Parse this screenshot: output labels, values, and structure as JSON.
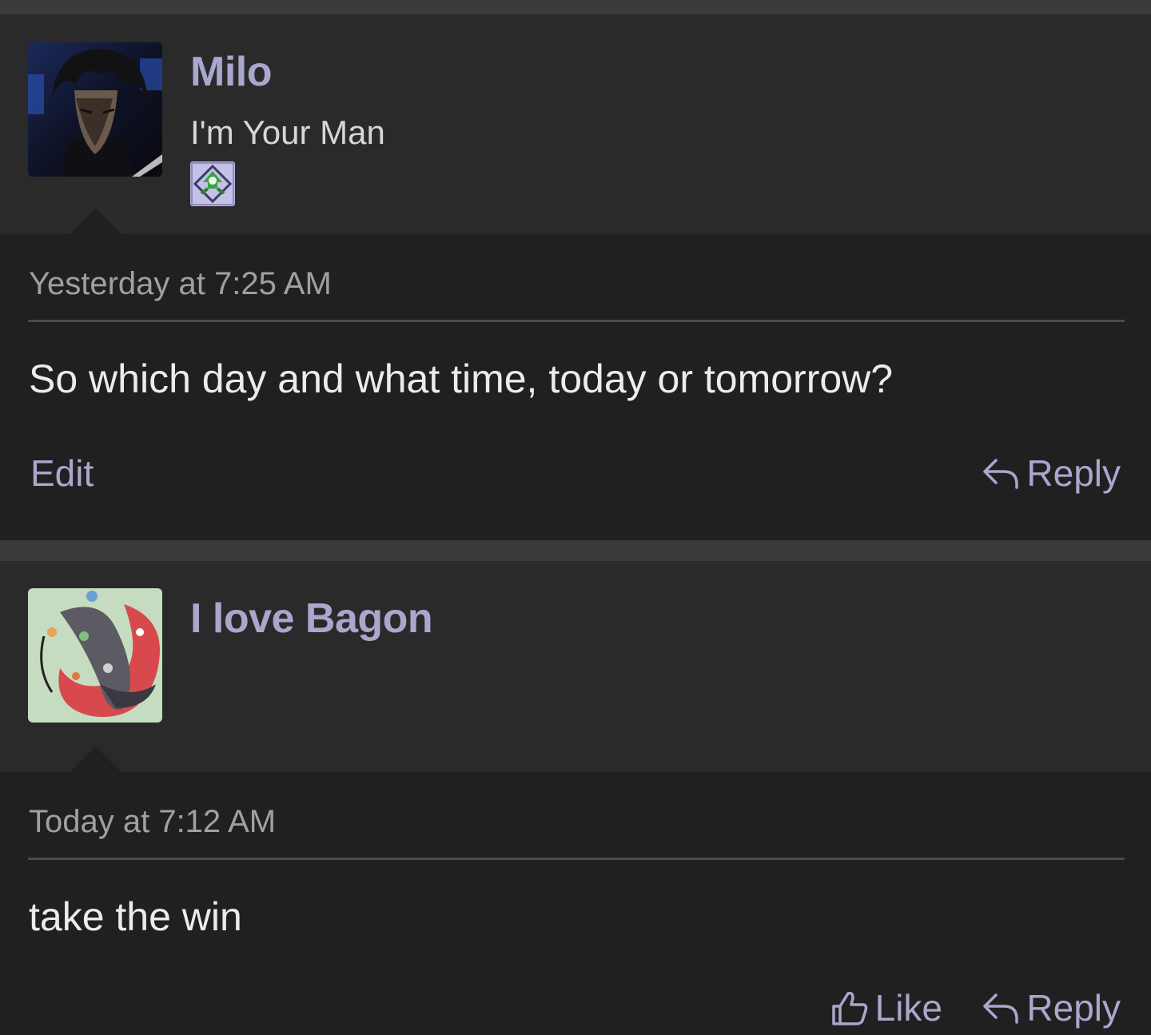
{
  "posts": [
    {
      "username": "Milo",
      "user_title": "I'm Your Man",
      "timestamp": "Yesterday at 7:25 AM",
      "message": "So which day and what time, today or tomorrow?",
      "actions": {
        "edit_label": "Edit",
        "reply_label": "Reply"
      }
    },
    {
      "username": "I love Bagon",
      "timestamp": "Today at 7:12 AM",
      "message": "take the win",
      "actions": {
        "like_label": "Like",
        "reply_label": "Reply"
      }
    }
  ],
  "colors": {
    "accent": "#a9a7cc",
    "background": "#202021",
    "user_area": "#2a2a2b",
    "text": "#ececec",
    "muted": "#a0a0a0"
  },
  "icons": [
    "reply-icon",
    "thumbs-up-icon",
    "badge-icon"
  ]
}
